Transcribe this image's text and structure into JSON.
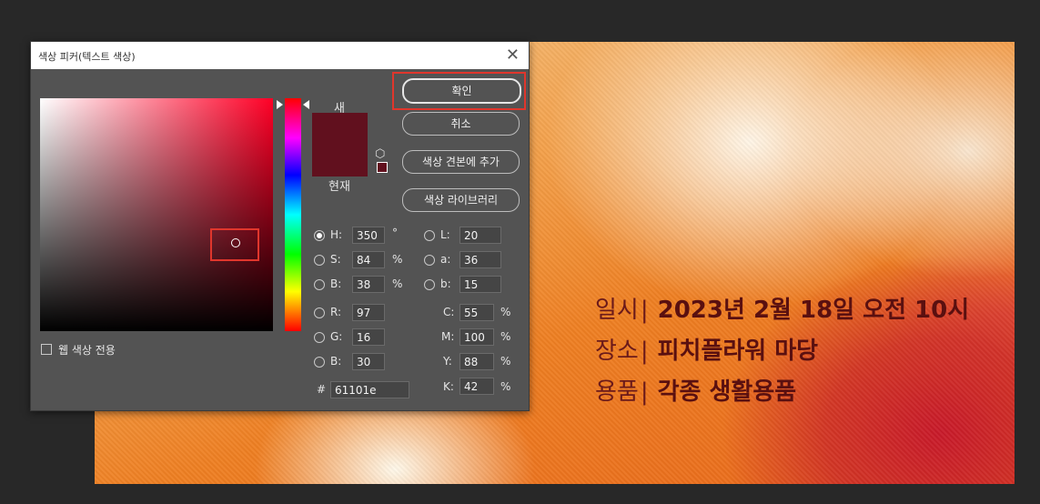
{
  "dialog": {
    "title": "색상 피커(텍스트 색상)",
    "close_glyph": "✕",
    "labels": {
      "new": "새",
      "current": "현재"
    },
    "buttons": {
      "ok": "확인",
      "cancel": "취소",
      "add_swatch": "색상 견본에 추가",
      "libraries": "색상 라이브러리"
    },
    "web_colors_only": "웹 색상 전용",
    "fields": {
      "H": {
        "label": "H:",
        "value": "350",
        "unit": "°"
      },
      "S": {
        "label": "S:",
        "value": "84",
        "unit": "%"
      },
      "B": {
        "label": "B:",
        "value": "38",
        "unit": "%"
      },
      "R": {
        "label": "R:",
        "value": "97"
      },
      "G": {
        "label": "G:",
        "value": "16"
      },
      "Bl": {
        "label": "B:",
        "value": "30"
      },
      "L": {
        "label": "L:",
        "value": "20"
      },
      "a": {
        "label": "a:",
        "value": "36"
      },
      "b": {
        "label": "b:",
        "value": "15"
      },
      "C": {
        "label": "C:",
        "value": "55",
        "unit": "%"
      },
      "M": {
        "label": "M:",
        "value": "100",
        "unit": "%"
      },
      "Y": {
        "label": "Y:",
        "value": "88",
        "unit": "%"
      },
      "K": {
        "label": "K:",
        "value": "42",
        "unit": "%"
      },
      "hex": {
        "label": "#",
        "value": "61101e"
      }
    },
    "selected_color": "#61101e",
    "highlight_color": "#e0362c"
  },
  "poster": {
    "lines": [
      {
        "label": "일시",
        "sep": "|",
        "value": "2023년 2월 18일 오전 10시"
      },
      {
        "label": "장소",
        "sep": "|",
        "value": "피치플라워 마당"
      },
      {
        "label": "용품",
        "sep": "|",
        "value": "각종 생활용품"
      }
    ]
  }
}
